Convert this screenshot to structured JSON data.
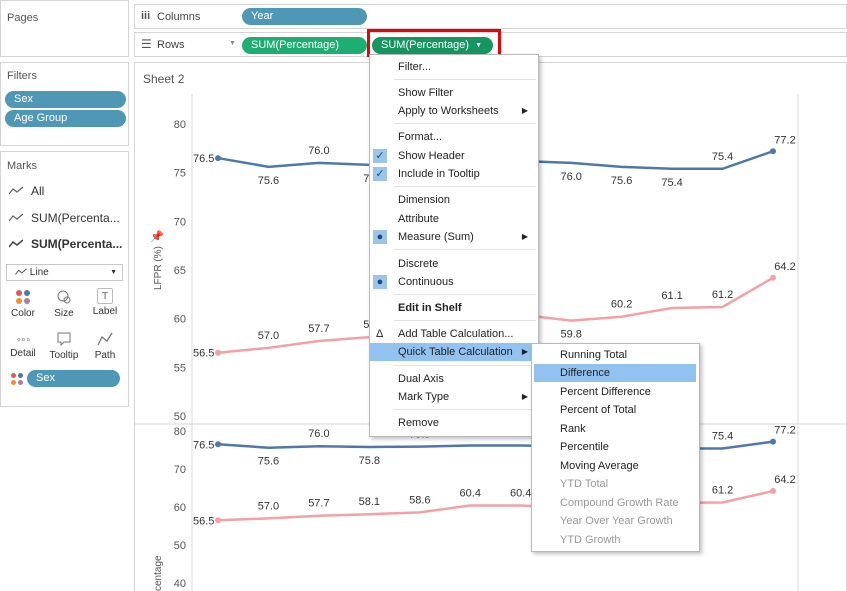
{
  "left_pane": {
    "pages_title": "Pages",
    "filters_title": "Filters",
    "filters": [
      "Sex",
      "Age Group"
    ],
    "marks_title": "Marks",
    "marks_items": [
      "All",
      "SUM(Percenta...",
      "SUM(Percenta..."
    ],
    "mark_type": "Line",
    "buttons": [
      "Color",
      "Size",
      "Label",
      "Detail",
      "Tooltip",
      "Path"
    ],
    "color_pill": "Sex"
  },
  "shelves": {
    "columns_label": "Columns",
    "columns_pill": "Year",
    "rows_label": "Rows",
    "rows_pill_1": "SUM(Percentage)",
    "rows_pill_2": "SUM(Percentage)"
  },
  "sheet": {
    "title": "Sheet 2"
  },
  "context_menu": [
    "Filter...",
    "Show Filter",
    "Apply to Worksheets",
    "Format...",
    "Show Header",
    "Include in Tooltip",
    "Dimension",
    "Attribute",
    "Measure (Sum)",
    "Discrete",
    "Continuous",
    "Edit in Shelf",
    "Add Table Calculation...",
    "Quick Table Calculation",
    "Dual Axis",
    "Mark Type",
    "Remove"
  ],
  "submenu": [
    "Running Total",
    "Difference",
    "Percent Difference",
    "Percent of Total",
    "Rank",
    "Percentile",
    "Moving Average",
    "YTD Total",
    "Compound Growth Rate",
    "Year Over Year Growth",
    "YTD Growth"
  ],
  "colors": {
    "series_male": "#4e79a7",
    "series_female": "#f4a0a8",
    "highlight": "#91c2f0",
    "red_box": "#e8000b"
  },
  "chart_data": [
    {
      "type": "line",
      "ylabel": "LFPR (%)",
      "ylim": [
        50,
        80
      ],
      "yticks": [
        80,
        75,
        70,
        65,
        60,
        55,
        50
      ],
      "series": [
        {
          "values": [
            76.5,
            75.6,
            76.0,
            75.8,
            75.9,
            76.2,
            76.2,
            76.0,
            75.6,
            75.4,
            75.4,
            77.2
          ],
          "labels": [
            "76.5",
            "75.6",
            "76.0",
            "75",
            "",
            "",
            "",
            "76.0",
            "75.6",
            "75.4",
            "75.4",
            "77.2"
          ]
        },
        {
          "values": [
            56.5,
            57.0,
            57.7,
            58.1,
            58.6,
            60.4,
            60.4,
            59.8,
            60.2,
            61.1,
            61.2,
            64.2
          ],
          "labels": [
            "56.5",
            "57.0",
            "57.7",
            "58",
            "",
            "",
            "",
            "59.8",
            "60.2",
            "61.1",
            "61.2",
            "64.2"
          ]
        }
      ]
    },
    {
      "type": "line",
      "ylabel": "centage",
      "ylim": [
        40,
        80
      ],
      "yticks": [
        80,
        70,
        60,
        50,
        40
      ],
      "series": [
        {
          "values": [
            76.5,
            75.6,
            76.0,
            75.8,
            75.9,
            76.2,
            76.2,
            76.0,
            75.6,
            75.4,
            75.4,
            77.2
          ],
          "labels": [
            "76.5",
            "75.6",
            "76.0",
            "75.8",
            "75.9",
            "",
            "76.2",
            "",
            "",
            "",
            "75.4",
            "77.2"
          ]
        },
        {
          "values": [
            56.5,
            57.0,
            57.7,
            58.1,
            58.6,
            60.4,
            60.4,
            59.8,
            60.2,
            61.1,
            61.2,
            64.2
          ],
          "labels": [
            "56.5",
            "57.0",
            "57.7",
            "58.1",
            "58.6",
            "60.4",
            "60.4",
            "",
            "",
            "",
            "61.2",
            "64.2"
          ]
        }
      ]
    }
  ]
}
